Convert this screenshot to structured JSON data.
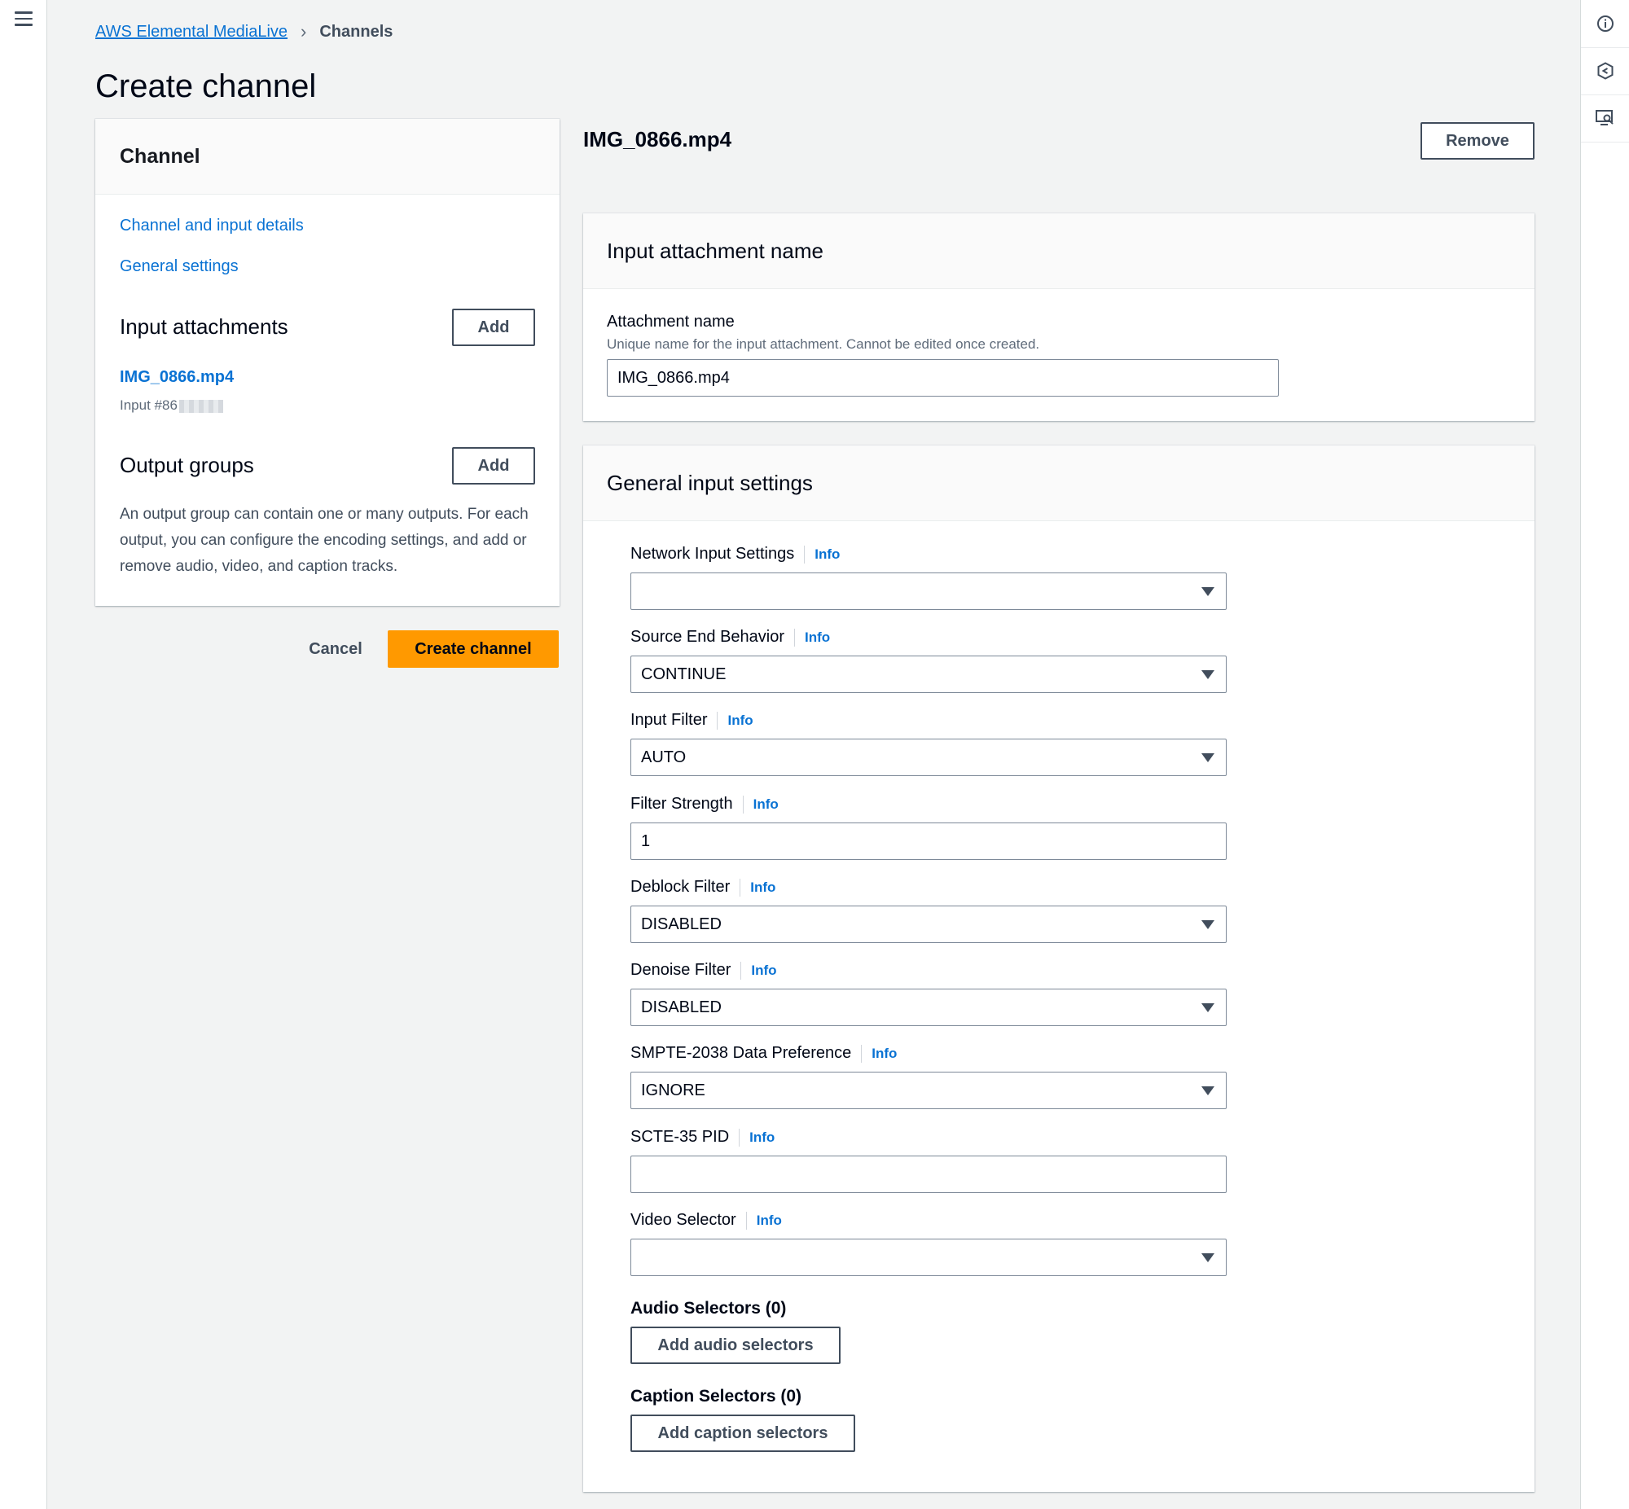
{
  "breadcrumb": {
    "root": "AWS Elemental MediaLive",
    "current": "Channels"
  },
  "page": {
    "title": "Create channel"
  },
  "nav": {
    "heading": "Channel",
    "links": [
      "Channel and input details",
      "General settings"
    ],
    "input_attachments": {
      "title": "Input attachments",
      "add_label": "Add",
      "item_name": "IMG_0866.mp4",
      "item_sub": "Input #86"
    },
    "output_groups": {
      "title": "Output groups",
      "add_label": "Add",
      "description": "An output group can contain one or many outputs. For each output, you can configure the encoding settings, and add or remove audio, video, and caption tracks."
    }
  },
  "actions": {
    "cancel": "Cancel",
    "create": "Create channel"
  },
  "main": {
    "title": "IMG_0866.mp4",
    "remove_label": "Remove",
    "attachment_card": {
      "heading": "Input attachment name",
      "field_label": "Attachment name",
      "field_desc": "Unique name for the input attachment. Cannot be edited once created.",
      "field_value": "IMG_0866.mp4"
    },
    "general_card": {
      "heading": "General input settings",
      "info_label": "Info",
      "fields": [
        {
          "label": "Network Input Settings",
          "value": ""
        },
        {
          "label": "Source End Behavior",
          "value": "CONTINUE"
        },
        {
          "label": "Input Filter",
          "value": "AUTO"
        },
        {
          "label": "Filter Strength",
          "value": "1"
        },
        {
          "label": "Deblock Filter",
          "value": "DISABLED"
        },
        {
          "label": "Denoise Filter",
          "value": "DISABLED"
        },
        {
          "label": "SMPTE-2038 Data Preference",
          "value": "IGNORE"
        },
        {
          "label": "SCTE-35 PID",
          "value": ""
        },
        {
          "label": "Video Selector",
          "value": ""
        }
      ],
      "audio_selectors": {
        "heading": "Audio Selectors (0)",
        "button": "Add audio selectors"
      },
      "caption_selectors": {
        "heading": "Caption Selectors (0)",
        "button": "Add caption selectors"
      }
    }
  },
  "colors": {
    "link": "#0972d3",
    "primary_button": "#ff9900",
    "page_bg": "#f2f3f3"
  },
  "icons": {
    "left_rail": "menu-icon",
    "right_rail": [
      "info-icon",
      "hexagon-feedback-icon",
      "screen-magnifier-icon"
    ]
  }
}
